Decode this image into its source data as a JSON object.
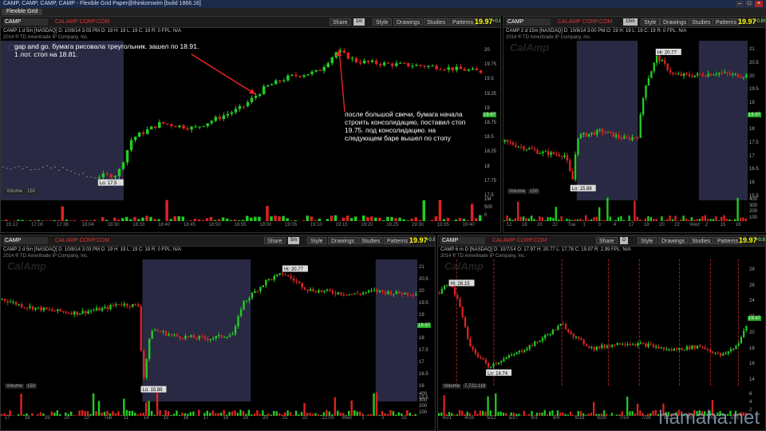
{
  "app": {
    "title": "CAMP, CAMP, CAMP, CAMP - Flexible Grid Paper@thinkorswim [build 1866.16]",
    "tab": "Flexible Grid"
  },
  "watermark_site": "hamaha.net",
  "chart_watermark": "CalAmp",
  "colors": {
    "up": "#22cc22",
    "down": "#dd2222",
    "highlight": "#4a4a7a",
    "price": "#ffff00"
  },
  "panels": [
    {
      "id": "p1",
      "symbol": "CAMP",
      "company": "CALAMP CORP.COM",
      "period": "1m",
      "price": "19.97",
      "change": "+0.8%",
      "buttons": [
        "Share",
        "Style",
        "Drawings",
        "Studies",
        "Patterns"
      ],
      "ohlc": "CAMP 1 d 5m [NASDAQ]   D: 10/8/14 3:03 PM   O: 19   H: 19   L: 19   C: 19   R: 0   FPL: N/A",
      "copyright": "2014 ® TD Ameritrade IP Company, Inc.",
      "low_label": "Lo: 17.5",
      "axis_labels": [
        "20",
        "19.75",
        "19.5",
        "19.25",
        "19",
        "18.75",
        "18.5",
        "18.25",
        "18",
        "17.75",
        "17.5"
      ],
      "volume_label": "Volume",
      "volume_value": "150",
      "vol_axis": [
        "1M",
        "500",
        "0"
      ],
      "time_labels": [
        "15:12",
        "17:00",
        "17:36",
        "18:04",
        "18:30",
        "18:33",
        "18:40",
        "18:45",
        "18:50",
        "18:55",
        "19:00",
        "19:05",
        "19:10",
        "19:15",
        "19:20",
        "19:25",
        "19:30",
        "19:35",
        "19:40"
      ]
    },
    {
      "id": "p2",
      "symbol": "CAMP",
      "company": "CALAMP CORP.COM",
      "period": "15m",
      "price": "19.97",
      "change": "+0.8%",
      "buttons": [
        "Style",
        "Drawings",
        "Studies",
        "Patterns"
      ],
      "ohlc": "CAMP 2 d 15m [NASDAQ]   D: 10/8/14 3:00 PM   O: 19   H: 19   L: 19   C: 19   R: 0   FPL: N/A",
      "copyright": "2014 ® TD Ameritrade IP Company, Inc.",
      "high_label": "Hi: 20.77",
      "low_label": "Lo: 15.88",
      "axis_labels": [
        "21",
        "20.5",
        "20",
        "19.5",
        "19",
        "18.5",
        "18",
        "17.5",
        "17",
        "16.5",
        "16",
        "15.5"
      ],
      "volume_label": "Volume",
      "volume_value": "150",
      "vol_axis": [
        "400",
        "300",
        "200",
        "100"
      ],
      "time_labels": [
        "12",
        "18",
        "20",
        "22",
        "Tue",
        "1",
        "3",
        "4",
        "17",
        "18",
        "20",
        "22",
        "Wed",
        "2",
        "15",
        "16"
      ]
    },
    {
      "id": "p3",
      "symbol": "CAMP",
      "company": "CALAMP CORP.COM",
      "period": "5m",
      "price": "19.97",
      "change": "+0.8%",
      "buttons": [
        "Share",
        "Style",
        "Drawings",
        "Studies",
        "Patterns"
      ],
      "ohlc": "CAMP 2 d 5m [NASDAQ]   D: 10/8/14 3:03 PM   O: 19   H: 19   L: 19   C: 19   R: 0   FPL: N/A",
      "copyright": "2014 ® TD Ameritrade IP Company, Inc.",
      "high_label": "Hi: 20.77",
      "low_label": "Lo: 15.88",
      "axis_labels": [
        "21",
        "20.5",
        "20",
        "19.5",
        "19",
        "18.5",
        "18",
        "17.5",
        "17",
        "16.5",
        "16",
        "15.5"
      ],
      "volume_label": "Volume",
      "volume_value": "150",
      "vol_axis": [
        "400",
        "300",
        "200",
        "100"
      ],
      "time_labels": [
        "17",
        "18",
        "19",
        "20",
        "22",
        "Tue",
        "11",
        "14",
        "15",
        "16",
        "17",
        "18",
        "19",
        "20",
        "21",
        "22",
        "22:05",
        "Wed",
        "1",
        "2",
        "15"
      ]
    },
    {
      "id": "p4",
      "symbol": "CAMP",
      "company": "CALAMP CORP.COM",
      "period": "D",
      "price": "19.97",
      "change": "+0.8%",
      "buttons": [
        "Share",
        "Style",
        "Drawings",
        "Studies",
        "Patterns"
      ],
      "ohlc": "CAMP 6 m D [NASDAQ]   D: 10/7/14   O: 17.97   H: 20.77   L: 17.78   C: 19.97   R: 2.99   FPL: N/A",
      "copyright": "2014 ® TD Ameritrade IP Company, Inc.",
      "high_label": "Hi: 26.15",
      "low_label": "Lo: 14.74",
      "axis_labels": [
        "28",
        "26",
        "24",
        "22",
        "20",
        "18",
        "16",
        "14"
      ],
      "volume_label": "Volume",
      "volume_value": "7,722,118",
      "vol_axis": [
        "6",
        "4",
        "2"
      ],
      "time_labels": [
        "4/21",
        "4/28",
        "5/12",
        "5/27",
        "6/3",
        "6/9",
        "6/16",
        "6/30",
        "7/14",
        "7/28",
        "8/11",
        "9/2",
        "9/15",
        "10/1"
      ]
    }
  ],
  "annotations": [
    "gap and go.  бумага рисовала треугольник. зашел по 18.91.",
    "1 лот. стоп на 18.81.",
    "после большой свечи, бумага начала",
    "строить консолидацию, поставил стоп",
    "19.75.  под консолидацию. на",
    "следующем баре вышел по стопу"
  ]
}
